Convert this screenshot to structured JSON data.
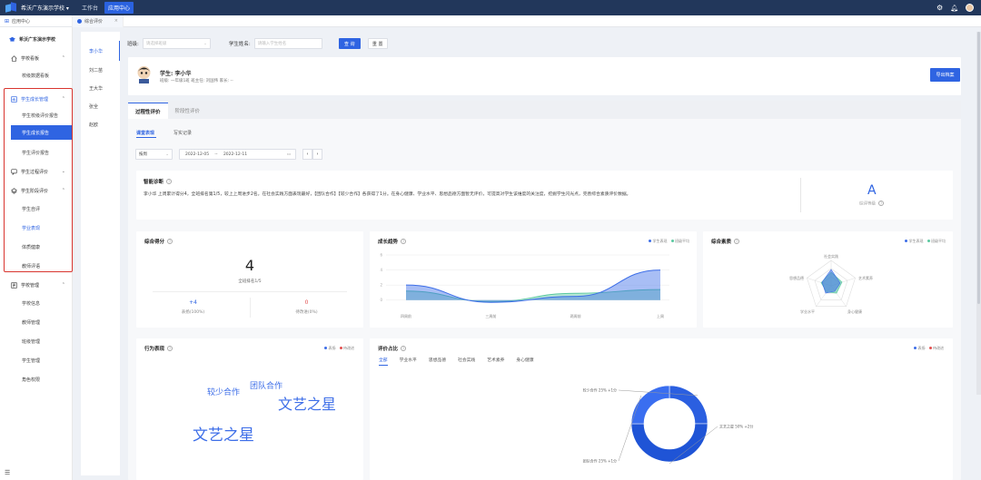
{
  "topbar": {
    "school": "希沃广东演示学校",
    "nav": [
      "工作台",
      "应用中心"
    ]
  },
  "tabs": [
    "应用中心",
    "综合评价"
  ],
  "sidebar": {
    "school_label": "希沃广东演示学校",
    "groups": [
      {
        "label": "学校看板",
        "icon": "dashboard-icon",
        "items": [
          "校级数据看板"
        ]
      },
      {
        "label": "学生成长管理",
        "icon": "growth-icon",
        "items": [
          "学生校级评价报告",
          "学生成长报告",
          "学生评价报告"
        ]
      },
      {
        "label": "学生过程评价",
        "icon": "process-icon",
        "items": []
      },
      {
        "label": "学生阶段评价",
        "icon": "stage-icon",
        "items": [
          "学生自评",
          "学业表现",
          "体质健康",
          "教师评语"
        ]
      },
      {
        "label": "学校管理",
        "icon": "school-icon",
        "items": [
          "学校信息",
          "教师管理",
          "班级管理",
          "学生管理",
          "角色权限"
        ]
      }
    ]
  },
  "students": [
    "李小华",
    "刘二苗",
    "王大华",
    "张全",
    "赵欧"
  ],
  "filter": {
    "class_label": "班级:",
    "class_placeholder": "请选择班级",
    "name_label": "学生姓名:",
    "name_placeholder": "请输入学生姓名",
    "search": "查 询",
    "reset": "重 置"
  },
  "profile": {
    "name": "学生: 李小华",
    "info": "班级: 一年级1班    班主任: 刘国伟    家长: --",
    "export": "导出档案"
  },
  "eval_tabs": [
    "过程性评价",
    "阶段性评价"
  ],
  "sub_tabs": [
    "课堂表现",
    "写实记录"
  ],
  "range": {
    "period": "按周",
    "start": "2022-12-05",
    "end": "2022-12-11"
  },
  "diagnosis": {
    "title": "智能诊断",
    "text": "李小华 上周累计得分4，全班排名第1/5，较上上周进步2名。在社会实践方面表现最好，【团队合作】【较少合作】各获得了1分。在身心健康、学业水平、思想品德方面暂无评价，可提高对学生该维度的关注度，挖掘学生闪光点，完善综合素质评价数据。",
    "grade": "A",
    "grade_label": "综评等级"
  },
  "score": {
    "title": "综合得分",
    "value": "4",
    "rank": "全班排名1/5",
    "plus_value": "+4",
    "plus_label": "表扬(100%)",
    "minus_value": "0",
    "minus_label": "待改进(0%)"
  },
  "trend": {
    "title": "成长趋势",
    "legend": [
      "学生表现",
      "班级平均"
    ],
    "colors": {
      "student": "#3d6ee8",
      "class": "#5ac8a0"
    }
  },
  "radar": {
    "title": "综合素质",
    "legend": [
      "学生表现",
      "班级平均"
    ],
    "labels": [
      "社会实践",
      "艺术素养",
      "身心健康",
      "学业水平",
      "思想品德"
    ]
  },
  "behavior": {
    "title": "行为表现",
    "legend": [
      "表扬",
      "待改进"
    ],
    "words": [
      "团队合作",
      "较少合作",
      "文艺之星",
      "文艺之星"
    ]
  },
  "ratio": {
    "title": "评价占比",
    "legend": [
      "表扬",
      "待改进"
    ],
    "tabs": [
      "全部",
      "学业水平",
      "思想品德",
      "社会实践",
      "艺术素养",
      "身心健康"
    ],
    "labels": [
      "较少合作 25% +1分",
      "文艺之星 50% +2分",
      "团队合作 25% +1分"
    ]
  },
  "chart_data": [
    {
      "type": "area",
      "title": "成长趋势",
      "categories": [
        "四周前",
        "三周前",
        "两周前",
        "上周"
      ],
      "ylim": [
        0,
        6
      ],
      "series": [
        {
          "name": "学生表现",
          "values": [
            2,
            -0.3,
            0.5,
            4
          ]
        },
        {
          "name": "班级平均",
          "values": [
            1.2,
            -0.2,
            0.9,
            1.4
          ]
        }
      ]
    },
    {
      "type": "pie",
      "title": "评价占比",
      "categories": [
        "较少合作",
        "文艺之星",
        "团队合作"
      ],
      "values": [
        25,
        50,
        25
      ]
    }
  ]
}
